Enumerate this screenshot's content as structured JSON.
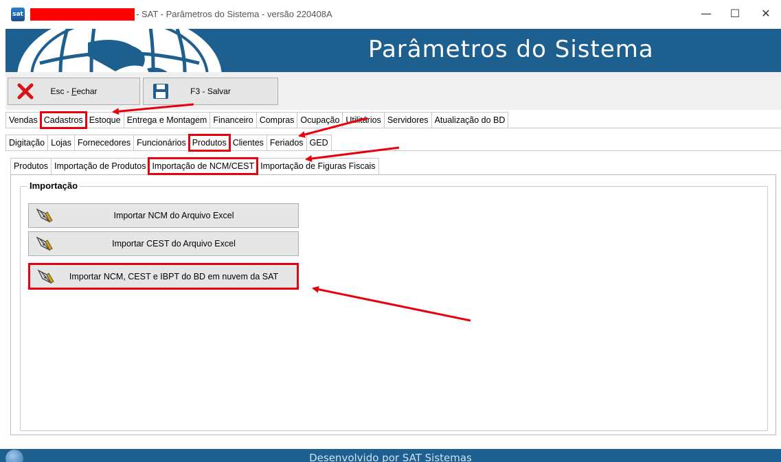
{
  "window": {
    "app_icon_text": "sat",
    "title": "- SAT - Parâmetros do Sistema - versão 220408A",
    "minimize_glyph": "—",
    "maximize_glyph": "☐",
    "close_glyph": "✕"
  },
  "banner": {
    "title": "Parâmetros do Sistema"
  },
  "toolbar": {
    "close_label_prefix": "Esc - ",
    "close_label_accel": "F",
    "close_label_rest": "echar",
    "save_label": "F3 - Salvar",
    "close_icon": "x-icon",
    "save_icon": "floppy-disk-icon"
  },
  "main_tabs": [
    {
      "label": "Vendas",
      "name": "tab-vendas"
    },
    {
      "label": "Cadastros",
      "name": "tab-cadastros",
      "active": true,
      "highlighted": true
    },
    {
      "label": "Estoque",
      "name": "tab-estoque"
    },
    {
      "label": "Entrega e Montagem",
      "name": "tab-entrega-e-montagem"
    },
    {
      "label": "Financeiro",
      "name": "tab-financeiro"
    },
    {
      "label": "Compras",
      "name": "tab-compras"
    },
    {
      "label": "Ocupação",
      "name": "tab-ocupacao"
    },
    {
      "label": "Utilitários",
      "name": "tab-utilitarios"
    },
    {
      "label": "Servidores",
      "name": "tab-servidores"
    },
    {
      "label": "Atualização do BD",
      "name": "tab-atualizacao-do-bd"
    }
  ],
  "sub_tabs": [
    {
      "label": "Digitação",
      "name": "tab-digitacao"
    },
    {
      "label": "Lojas",
      "name": "tab-lojas"
    },
    {
      "label": "Fornecedores",
      "name": "tab-fornecedores"
    },
    {
      "label": "Funcionários",
      "name": "tab-funcionarios"
    },
    {
      "label": "Produtos",
      "name": "tab-produtos",
      "active": true,
      "highlighted": true
    },
    {
      "label": "Clientes",
      "name": "tab-clientes"
    },
    {
      "label": "Feriados",
      "name": "tab-feriados"
    },
    {
      "label": "GED",
      "name": "tab-ged"
    }
  ],
  "third_tabs": [
    {
      "label": "Produtos",
      "name": "tab-produtos-lista"
    },
    {
      "label": "Importação de Produtos",
      "name": "tab-importacao-de-produtos"
    },
    {
      "label": "Importação de NCM/CEST",
      "name": "tab-importacao-ncm-cest",
      "active": true,
      "highlighted": true
    },
    {
      "label": "Importação de Figuras Fiscais",
      "name": "tab-importacao-figuras-fiscais"
    }
  ],
  "import_group": {
    "label": "Importação",
    "buttons": [
      {
        "label": "Importar NCM do Arquivo Excel",
        "icon": "pen-nib-icon"
      },
      {
        "label": "Importar CEST do Arquivo Excel",
        "icon": "pen-nib-icon"
      },
      {
        "label": "Importar NCM, CEST e IBPT do BD em nuvem da SAT",
        "icon": "pen-nib-icon",
        "highlighted": true
      }
    ]
  },
  "footer": {
    "text": "Desenvolvido por SAT Sistemas"
  },
  "colors": {
    "banner": "#1d5f8e",
    "annotation": "#e8000c"
  }
}
